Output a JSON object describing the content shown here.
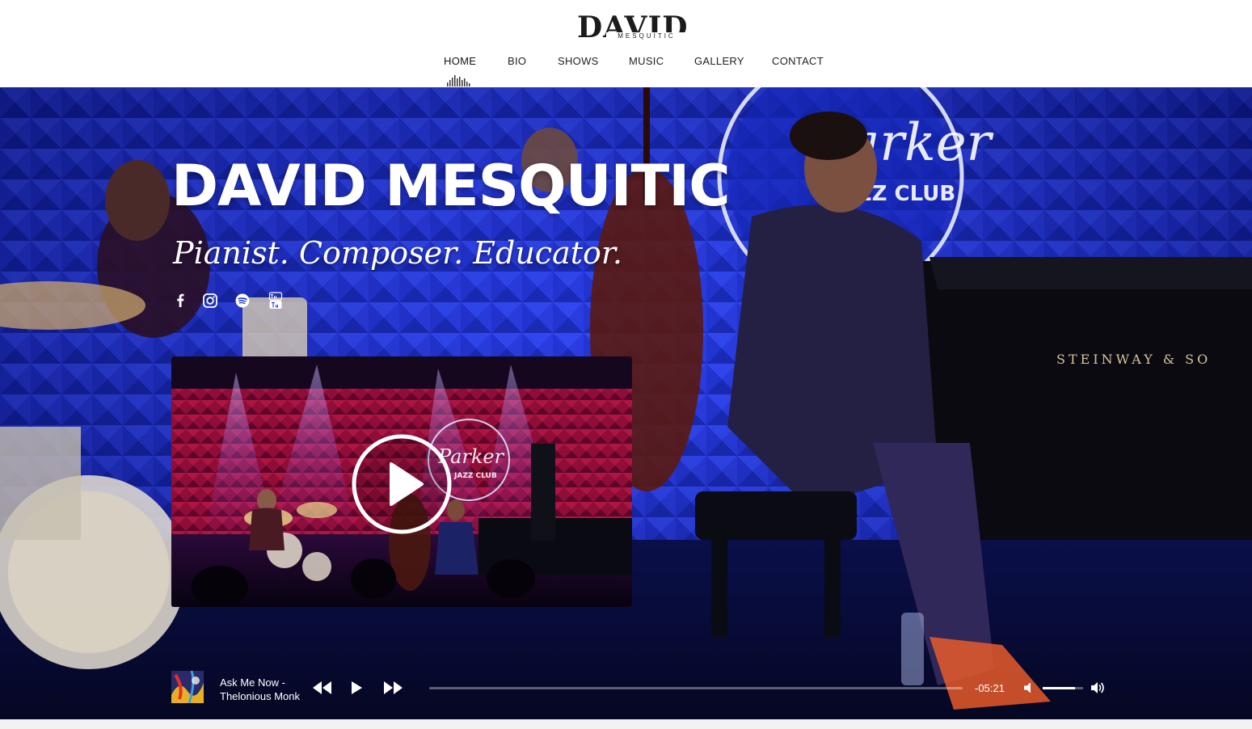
{
  "logo": {
    "main": "DAVID",
    "sub": "MESQUITIC"
  },
  "nav": {
    "items": [
      {
        "label": "HOME",
        "active": true
      },
      {
        "label": "BIO"
      },
      {
        "label": "SHOWS"
      },
      {
        "label": "MUSIC"
      },
      {
        "label": "GALLERY"
      },
      {
        "label": "CONTACT"
      }
    ]
  },
  "hero": {
    "title": "DAVID MESQUITIC",
    "subtitle": "Pianist. Composer. Educator.",
    "background_sign_lines": [
      "Parker",
      "JAZZ CLUB"
    ],
    "background_piano_brand": "STEINWAY & SO",
    "social": [
      {
        "icon": "facebook-icon"
      },
      {
        "icon": "instagram-icon"
      },
      {
        "icon": "spotify-icon"
      },
      {
        "icon": "youtube-icon"
      }
    ]
  },
  "video": {
    "sign_lines": [
      "Parker",
      "JAZZ CLUB"
    ],
    "icon": "play-icon"
  },
  "player": {
    "track_title": "Ask Me Now - Thelonious Monk",
    "time_remaining": "-05:21",
    "progress": 0,
    "volume": 0.8,
    "icons": {
      "rewind": "rewind-icon",
      "play": "play-icon",
      "forward": "fast-forward-icon",
      "mute": "volume-mute-icon",
      "volume_max": "volume-up-icon"
    }
  },
  "colors": {
    "accent_blue": "#1a2fd6",
    "nav_text": "#222222",
    "hero_text": "#ffffff"
  }
}
